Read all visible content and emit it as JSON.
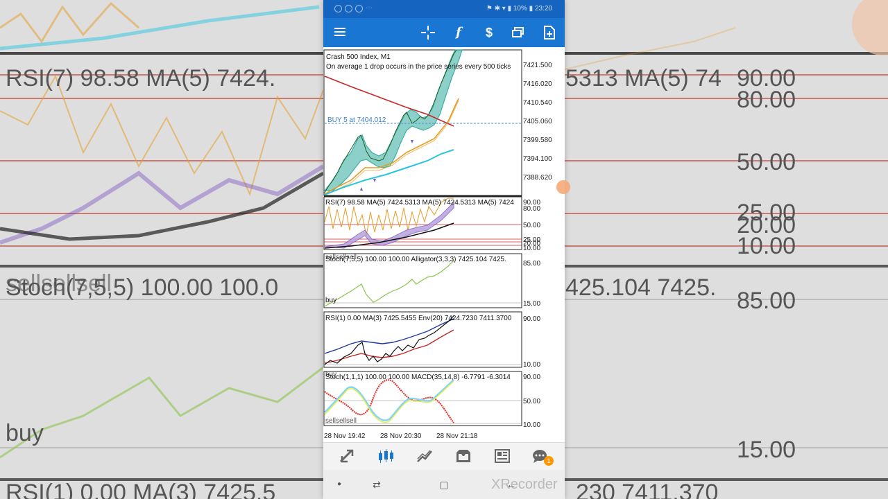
{
  "status_bar": {
    "battery": "10%",
    "time": "23:20"
  },
  "toolbar": {
    "menu_icon": "hamburger-icon",
    "crosshair_icon": "crosshair-icon",
    "indicators_icon": "function-icon",
    "trade_icon": "dollar-icon",
    "windows_icon": "windows-icon",
    "new_order_icon": "new-document-icon"
  },
  "main_chart": {
    "title": "Crash 500 Index, M1",
    "description": "On average 1 drop occurs in the price series every 500 ticks",
    "order_label": "BUY 5 at 7404.012",
    "price_ticks": [
      "7421.500",
      "7416.020",
      "7410.540",
      "7405.060",
      "7399.580",
      "7394.100",
      "7388.620"
    ]
  },
  "panel_rsi7": {
    "label": "RSI(7) 98.58 MA(5) 7424.5313 MA(5) 7424.5313 MA(5) 7424",
    "levels": [
      "90.00",
      "80.00",
      "50.00",
      "25.00",
      "20.00",
      "10.00"
    ]
  },
  "panel_stoch": {
    "label": "Stoch(7,5,5) 100.00 100.00 Alligator(3,3,3) 7425.104 7425.",
    "overlay_text": "sellsellsell",
    "buy_text": "buy",
    "levels": [
      "85.00",
      "15.00"
    ]
  },
  "panel_rsi1": {
    "label": "RSI(1) 0.00 MA(3) 7425.5455 Env(20) 7424.7230 7411.3700",
    "levels": [
      "90.00",
      "10.00"
    ]
  },
  "panel_stoch2": {
    "label": "Stoch(1,1,1) 100.00 100.00 MACD(35,14,8) -6.7791 -6.3014",
    "buy_text": "buy",
    "sell_text": "sellsellsell",
    "levels": [
      "90.00",
      "50.00",
      "10.00"
    ]
  },
  "time_axis": [
    "28 Nov 19:42",
    "28 Nov 20:30",
    "28 Nov 21:18"
  ],
  "bottom_nav": {
    "items": [
      "quotes-icon",
      "chart-icon",
      "trade-icon",
      "history-icon",
      "news-icon",
      "chat-icon"
    ],
    "chat_badge": "1"
  },
  "background": {
    "rsi_label": "RSI(7) 98.58 MA(5) 7424.",
    "rsi_label_right": "5313 MA(5) 74",
    "stoch_label": "Stoch(7,5,5) 100.00 100.0",
    "stoch_label_right": "425.104 7425.",
    "overlay": "sellsellsell",
    "buy": "buy",
    "levels": [
      "90.00",
      "80.00",
      "50.00",
      "25.00",
      "20.00",
      "10.00",
      "85.00",
      "15.00"
    ],
    "bottom_label": "RSI(1) 0.00 MA(3) 7425.5",
    "bottom_label_right": "230 7411.370"
  },
  "watermark": "XRecorder",
  "colors": {
    "toolbar": "#1976d2",
    "status_bar": "#1565c0",
    "teal": "#26a69a",
    "orange": "#e69c24",
    "red_ma": "#c62828",
    "cyan_ma": "#29c5e0",
    "purple": "#7e57c2",
    "green": "#8bc34a",
    "blue_line": "#1e3a9e"
  }
}
